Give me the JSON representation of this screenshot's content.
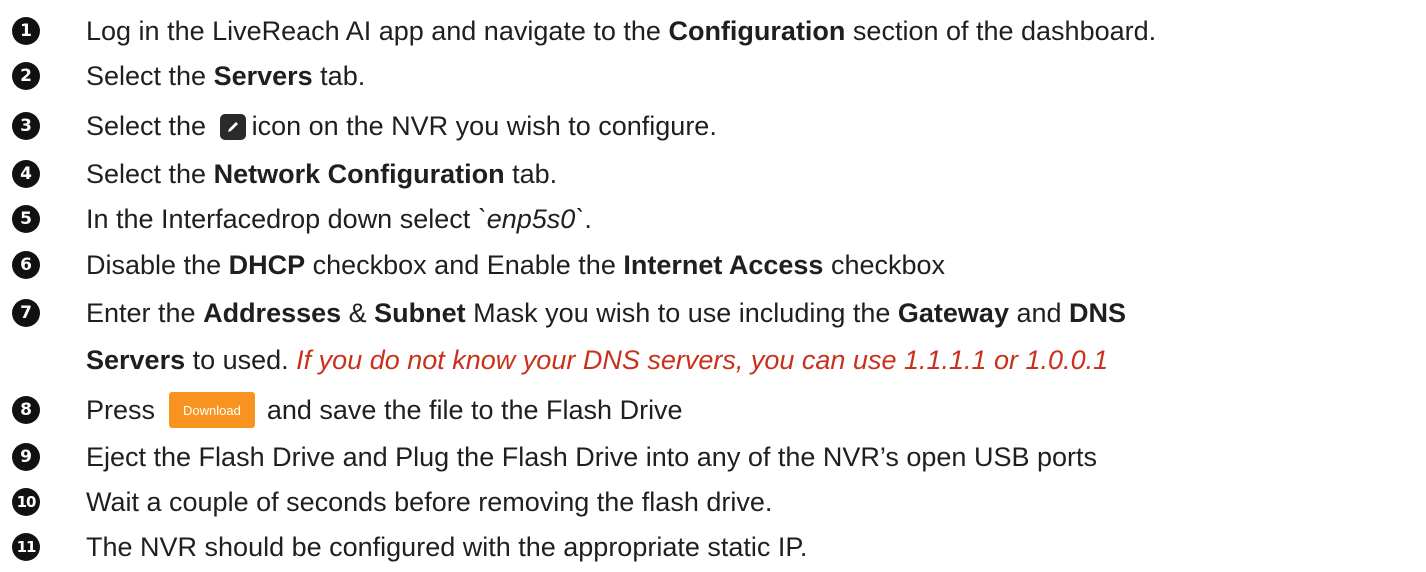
{
  "steps": [
    {
      "num": "1",
      "parts": [
        "Log in the LiveReach AI app and navigate to the ",
        "Configuration",
        " section of the dashboard."
      ]
    },
    {
      "num": "2",
      "parts": [
        "Select the ",
        "Servers",
        " tab."
      ]
    },
    {
      "num": "3",
      "parts": [
        "Select the ",
        "icon on the NVR you wish to configure."
      ],
      "icon": "edit-pencil-icon"
    },
    {
      "num": "4",
      "parts": [
        "Select the ",
        "Network Configuration",
        " tab."
      ]
    },
    {
      "num": "5",
      "parts": [
        "In the Interfacedrop down select ",
        "`enp5s0`",
        "."
      ]
    },
    {
      "num": "6",
      "parts": [
        "Disable the ",
        "DHCP",
        " checkbox and Enable the ",
        "Internet Access",
        " checkbox"
      ]
    },
    {
      "num": "7",
      "parts": [
        "Enter the ",
        "Addresses",
        " & ",
        "Subnet",
        " Mask you wish to use including the ",
        "Gateway",
        " and ",
        "DNS"
      ],
      "cont": [
        "Servers",
        " to used. ",
        "If you do not know your DNS servers, you can use 1.1.1.1 or 1.0.0.1"
      ]
    },
    {
      "num": "8",
      "parts": [
        "Press",
        "and save the file to the Flash Drive"
      ],
      "button": "Download"
    },
    {
      "num": "9",
      "parts": [
        "Eject the Flash Drive and Plug the Flash Drive into any of the NVR’s open USB ports"
      ]
    },
    {
      "num": "10",
      "parts": [
        "Wait a couple of seconds before removing the flash drive."
      ]
    },
    {
      "num": "11",
      "parts": [
        "The NVR should be configured with the appropriate static IP."
      ]
    }
  ],
  "colors": {
    "accent_button": "#f7931e",
    "note_red": "#c8321c",
    "number_badge": "#111111"
  }
}
